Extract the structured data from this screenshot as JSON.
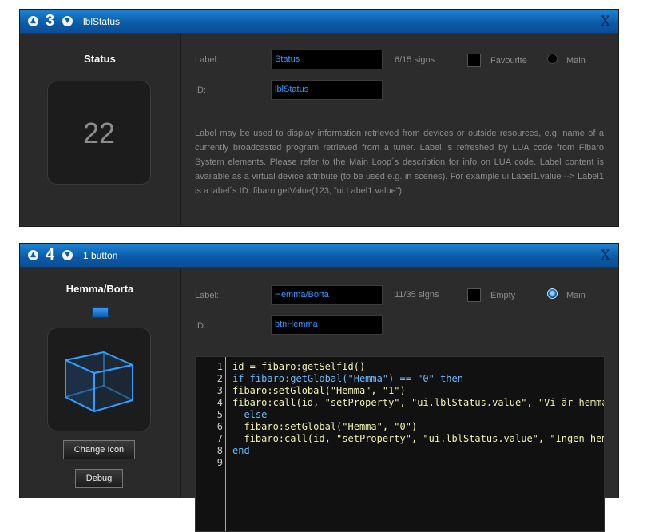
{
  "panel1": {
    "number": "3",
    "title": "lblStatus",
    "close": "X",
    "preview_name": "Status",
    "preview_value": "22",
    "label_caption": "Label:",
    "label_value": "Status",
    "signs": "6/15 signs",
    "checkbox_label": "Favourite",
    "radio_label": "Main",
    "id_caption": "ID:",
    "id_value": "lblStatus",
    "description": "Label may be used to display information retrieved from devices or outside resources, e.g. name of a currently broadcasted program retrieved from a tuner. Label is refreshed by LUA code from Fibaro System elements. Please refer to the Main Loop´s description for info on LUA code. Label content is available as a virtual device attribute (to be used e.g. in scenes). For example ui.Label1.value --> Label1 is a label´s ID: fibaro:getValue(123, ”ui.Label1.value”)"
  },
  "panel2": {
    "number": "4",
    "title": "1 button",
    "close": "X",
    "preview_name": "Hemma/Borta",
    "label_caption": "Label:",
    "label_value": "Hemma/Borta",
    "signs": "11/35 signs",
    "checkbox_label": "Empty",
    "radio_label": "Main",
    "id_caption": "ID:",
    "id_value": "btnHemma",
    "change_icon": "Change Icon",
    "debug": "Debug",
    "line_numbers": [
      "1",
      "2",
      "3",
      "4",
      "5",
      "6",
      "7",
      "8",
      "9"
    ],
    "code_lines": [
      "id = fibaro:getSelfId()",
      "if fibaro:getGlobal(\"Hemma\") == \"0\" then",
      "fibaro:setGlobal(\"Hemma\", \"1\")",
      "fibaro:call(id, \"setProperty\", \"ui.lblStatus.value\", \"Vi är hemma\")",
      "  else",
      "  fibaro:setGlobal(\"Hemma\", \"0\")",
      "  fibaro:call(id, \"setProperty\", \"ui.lblStatus.value\", \"Ingen hemma\")",
      "end",
      ""
    ]
  },
  "colors": {
    "header_blue": "#0b5aa8",
    "input_text": "#3399ff",
    "code_keyword": "#66bbff"
  },
  "icons": [
    "chevron-up-icon",
    "chevron-down-icon",
    "close-icon",
    "cube-icon"
  ]
}
